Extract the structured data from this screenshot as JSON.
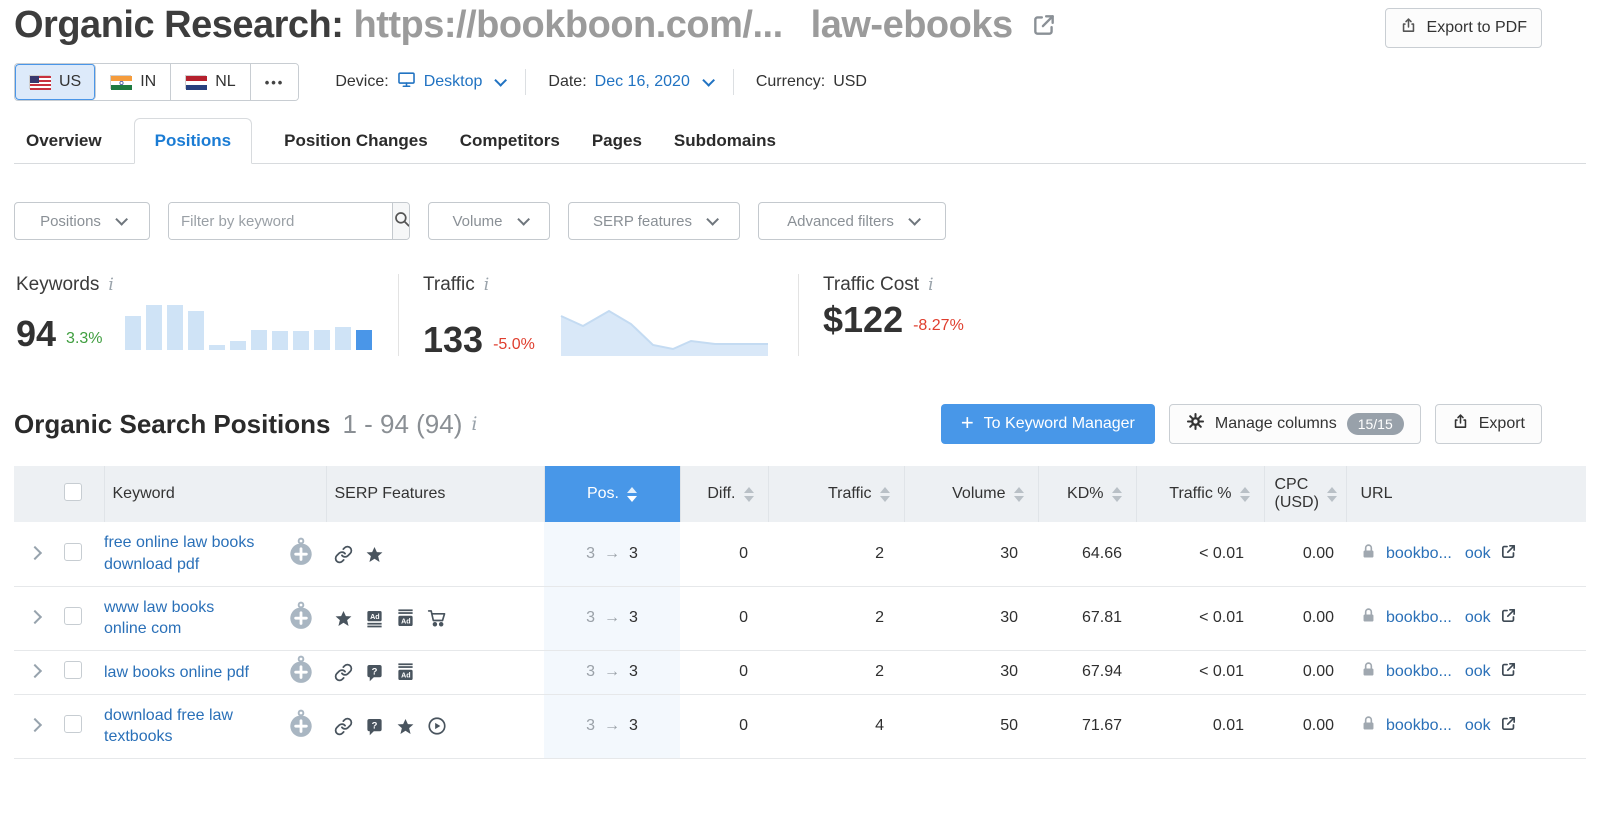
{
  "page": {
    "title_prefix": "Organic Research: ",
    "title_url": "https://bookboon.com/...",
    "title_tail": "law-ebooks",
    "export_pdf_label": "Export to PDF"
  },
  "toolbar": {
    "countries": [
      {
        "code": "US",
        "selected": true
      },
      {
        "code": "IN",
        "selected": false
      },
      {
        "code": "NL",
        "selected": false
      }
    ],
    "more_label": "•••",
    "device_label": "Device:",
    "device_value": "Desktop",
    "date_label": "Date:",
    "date_value": "Dec 16, 2020",
    "currency_label": "Currency:",
    "currency_value": "USD"
  },
  "tabs": [
    {
      "label": "Overview"
    },
    {
      "label": "Positions"
    },
    {
      "label": "Position Changes"
    },
    {
      "label": "Competitors"
    },
    {
      "label": "Pages"
    },
    {
      "label": "Subdomains"
    }
  ],
  "filters": {
    "positions_label": "Positions",
    "keyword_placeholder": "Filter by keyword",
    "volume_label": "Volume",
    "serp_label": "SERP features",
    "advanced_label": "Advanced filters"
  },
  "stats": {
    "keywords": {
      "label": "Keywords",
      "value": "94",
      "change": "3.3%",
      "bars": [
        34,
        45,
        45,
        39,
        5,
        9,
        20,
        19,
        19,
        20,
        23,
        20
      ]
    },
    "traffic": {
      "label": "Traffic",
      "value": "133",
      "change": "-5.0%",
      "spark": [
        [
          2,
          12
        ],
        [
          24,
          22
        ],
        [
          50,
          7
        ],
        [
          72,
          20
        ],
        [
          94,
          41
        ],
        [
          114,
          45
        ],
        [
          132,
          37
        ],
        [
          156,
          40
        ],
        [
          180,
          40
        ],
        [
          205,
          40
        ],
        [
          220,
          40
        ]
      ]
    },
    "traffic_cost": {
      "label": "Traffic Cost",
      "value": "$122",
      "change": "-8.27%"
    }
  },
  "section": {
    "title": "Organic Search Positions",
    "range": "1 - 94 (94)",
    "keyword_manager_label": "To Keyword Manager",
    "manage_columns_label": "Manage columns",
    "columns_badge": "15/15",
    "export_label": "Export"
  },
  "table": {
    "pos_arrow": "→",
    "headers": {
      "keyword": "Keyword",
      "serp": "SERP Features",
      "pos": "Pos.",
      "diff": "Diff.",
      "traffic": "Traffic",
      "volume": "Volume",
      "kd": "KD%",
      "traffic_pct": "Traffic %",
      "cpc_line1": "CPC",
      "cpc_line2": "(USD)",
      "url": "URL"
    },
    "rows": [
      {
        "keyword": "free online law books download pdf",
        "serp_features": [
          "link",
          "star"
        ],
        "pos_old": "3",
        "pos_new": "3",
        "diff": "0",
        "traffic": "2",
        "volume": "30",
        "kd": "64.66",
        "traffic_pct": "< 0.01",
        "cpc": "0.00",
        "url_start": "bookbo...",
        "url_end": "ook"
      },
      {
        "keyword": "www law books online com",
        "serp_features": [
          "star",
          "ads-top",
          "ads-bottom",
          "cart"
        ],
        "pos_old": "3",
        "pos_new": "3",
        "diff": "0",
        "traffic": "2",
        "volume": "30",
        "kd": "67.81",
        "traffic_pct": "< 0.01",
        "cpc": "0.00",
        "url_start": "bookbo...",
        "url_end": "ook"
      },
      {
        "keyword": "law books online pdf",
        "serp_features": [
          "link",
          "faq",
          "ads-bottom"
        ],
        "pos_old": "3",
        "pos_new": "3",
        "diff": "0",
        "traffic": "2",
        "volume": "30",
        "kd": "67.94",
        "traffic_pct": "< 0.01",
        "cpc": "0.00",
        "url_start": "bookbo...",
        "url_end": "ook"
      },
      {
        "keyword": "download free law textbooks",
        "serp_features": [
          "link",
          "faq",
          "star",
          "video"
        ],
        "pos_old": "3",
        "pos_new": "3",
        "diff": "0",
        "traffic": "4",
        "volume": "50",
        "kd": "71.67",
        "traffic_pct": "0.01",
        "cpc": "0.00",
        "url_start": "bookbo...",
        "url_end": "ook"
      }
    ]
  },
  "colors": {
    "accent_blue": "#4897e8",
    "link_blue": "#2a70b8",
    "positive_green": "#3f9e3f",
    "negative_red": "#df3e2e",
    "bar_light": "#cfe3f6",
    "bar_highlight": "#4a96e8",
    "header_bg": "#edf0f3",
    "pos_col_bg": "#f3f8fd"
  }
}
